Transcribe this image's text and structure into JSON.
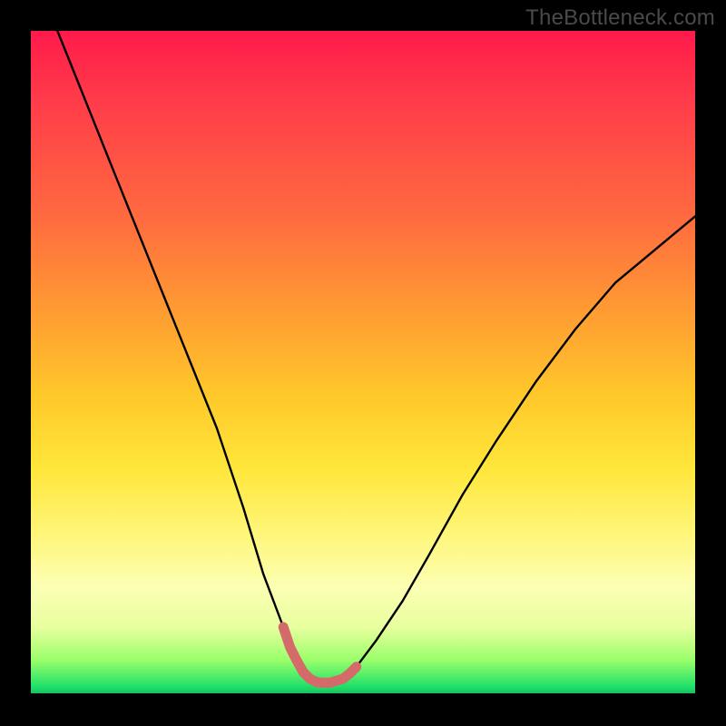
{
  "watermark": "TheBottleneck.com",
  "chart_data": {
    "type": "line",
    "title": "",
    "xlabel": "",
    "ylabel": "",
    "xlim": [
      0,
      100
    ],
    "ylim": [
      0,
      100
    ],
    "series": [
      {
        "name": "bottleneck-curve",
        "color": "#000000",
        "x": [
          4,
          8,
          12,
          16,
          20,
          24,
          28,
          32,
          35,
          38,
          40,
          42,
          43.5,
          45,
          47,
          49,
          52,
          56,
          60,
          65,
          70,
          76,
          82,
          88,
          94,
          100
        ],
        "y": [
          100,
          90,
          80,
          70,
          60,
          50,
          40,
          28,
          18,
          10,
          5,
          2.2,
          1.6,
          1.6,
          2.2,
          4,
          8,
          14,
          21,
          30,
          38,
          47,
          55,
          62,
          67,
          72
        ]
      },
      {
        "name": "optimal-highlight",
        "color": "#d46a6a",
        "x": [
          38,
          39,
          40,
          41,
          42,
          43,
          44,
          45,
          46,
          47,
          48,
          49
        ],
        "y": [
          10,
          7,
          5,
          3.2,
          2.2,
          1.7,
          1.6,
          1.6,
          1.9,
          2.2,
          3.0,
          4.0
        ]
      }
    ],
    "gradient_stops": [
      {
        "pos": 0,
        "color": "#ff1a4b"
      },
      {
        "pos": 28,
        "color": "#ff6a3f"
      },
      {
        "pos": 55,
        "color": "#ffc82a"
      },
      {
        "pos": 76,
        "color": "#fff67a"
      },
      {
        "pos": 95,
        "color": "#9aff6a"
      },
      {
        "pos": 100,
        "color": "#18c060"
      }
    ]
  }
}
